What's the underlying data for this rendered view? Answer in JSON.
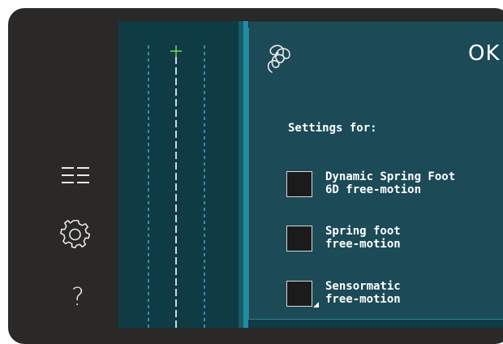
{
  "sidebar": {
    "icons": [
      "list-view-icon",
      "gear-icon"
    ],
    "help_label": "?"
  },
  "popup": {
    "ok_label": "OK",
    "icon": "free-motion-icon",
    "settings_title": "Settings for:",
    "options": [
      {
        "label": "Dynamic Spring Foot\n6D free-motion",
        "checked": false
      },
      {
        "label": "Spring foot\nfree-motion",
        "checked": false
      },
      {
        "label": "Sensormatic\nfree-motion",
        "checked": false
      }
    ]
  },
  "colors": {
    "screen_bg": "#0f3b45",
    "popup_bg": "#1c4a57",
    "accent": "#1f8ea3",
    "needle_marker": "#7ed957"
  }
}
